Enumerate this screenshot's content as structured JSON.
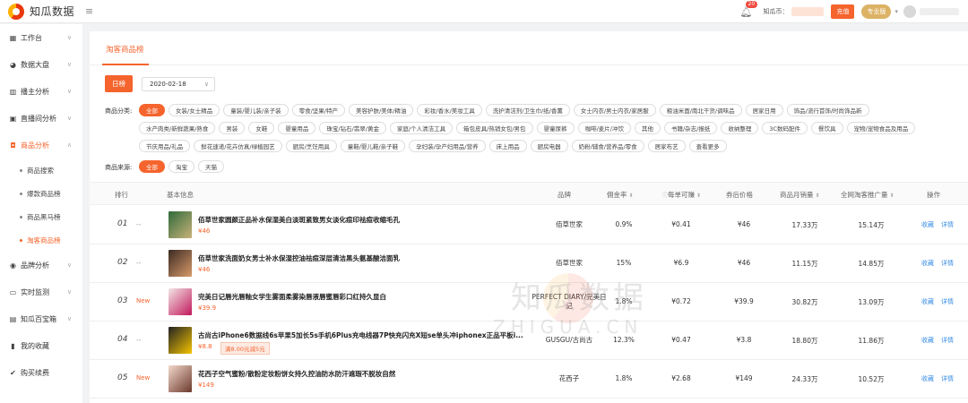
{
  "header": {
    "logo_text": "知瓜数据",
    "menu_icon": "menu-icon",
    "bell_badge": "20",
    "coin_label": "知瓜币：",
    "recharge_label": "充值",
    "vip_label": "专业版"
  },
  "sidebar": {
    "items": [
      {
        "label": "工作台",
        "icon": "grid-icon"
      },
      {
        "label": "数据大盘",
        "icon": "pie-icon"
      },
      {
        "label": "播主分析",
        "icon": "bar-icon"
      },
      {
        "label": "直播间分析",
        "icon": "tv-icon"
      },
      {
        "label": "商品分析",
        "icon": "bag-icon"
      },
      {
        "label": "品牌分析",
        "icon": "target-icon"
      },
      {
        "label": "实时监测",
        "icon": "monitor-icon"
      },
      {
        "label": "知瓜百宝箱",
        "icon": "box-icon"
      },
      {
        "label": "我的收藏",
        "icon": "bookmark-icon"
      },
      {
        "label": "购买续费",
        "icon": "cart-icon"
      }
    ],
    "sub_items": [
      "商品搜索",
      "爆款商品榜",
      "商品黑马榜",
      "淘客商品榜"
    ]
  },
  "main": {
    "tab_label": "淘客商品榜",
    "day_button": "日榜",
    "date_value": "2020-02-18",
    "category_label": "商品分类:",
    "categories": [
      "全部",
      "女装/女士精品",
      "童装/婴儿装/亲子装",
      "零食/坚果/特产",
      "美容护肤/美体/精油",
      "彩妆/香水/美妆工具",
      "洗护清洁剂/卫生巾/纸/香薰",
      "女士内衣/男士内衣/家居服",
      "粮油米面/南北干货/调味品",
      "居家日用",
      "饰品/流行首饰/时尚饰品新",
      "水产肉类/新鲜蔬果/熟食",
      "男装",
      "女鞋",
      "婴童用品",
      "珠宝/钻石/翡翠/黄金",
      "家庭/个人清洁工具",
      "箱包皮具/热销女包/男包",
      "婴童尿裤",
      "咖啡/麦片/冲饮",
      "其他",
      "书籍/杂志/报纸",
      "收纳整理",
      "3C数码配件",
      "餐饮具",
      "宠物/宠物食品及用品",
      "节庆用品/礼品",
      "鲜花速递/花卉仿真/绿植园艺",
      "厨房/烹饪用具",
      "童鞋/婴儿鞋/亲子鞋",
      "孕妇装/孕产妇用品/营养",
      "床上用品",
      "厨房电器",
      "奶粉/辅食/营养品/零食",
      "居家布艺",
      "查看更多"
    ],
    "source_label": "商品来源:",
    "sources": [
      "全部",
      "淘宝",
      "天猫"
    ],
    "table": {
      "headers": {
        "rank": "排行",
        "info": "基本信息",
        "brand": "品牌",
        "commission": "佣金率",
        "per_order": "每单可赚",
        "after_coupon": "券后价格",
        "monthly_sales": "商品月销量",
        "promo_count": "全网淘客推广量",
        "action": "操作"
      },
      "rows": [
        {
          "rank": "01",
          "trend": "--",
          "name": "佰草世家圆颜正品补水保湿美白淡斑紧致男女淡化痘印祛痘收缩毛孔",
          "price": "¥46",
          "promo": "",
          "brand": "佰草世家",
          "commission": "0.9%",
          "per_order": "¥0.41",
          "after_coupon": "¥46",
          "monthly_sales": "17.33万",
          "promo_count": "15.14万"
        },
        {
          "rank": "02",
          "trend": "--",
          "name": "佰草世家洗面奶女男士补水保湿控油祛痘深层清洁黑头氨基酸洁面乳",
          "price": "¥46",
          "promo": "",
          "brand": "佰草世家",
          "commission": "15%",
          "per_order": "¥6.9",
          "after_coupon": "¥46",
          "monthly_sales": "11.15万",
          "promo_count": "14.85万"
        },
        {
          "rank": "03",
          "trend": "New",
          "name": "完美日记唇光唇釉女学生雾面柔雾染唇液唇蜜唇彩口红持久显白",
          "price": "¥39.9",
          "promo": "",
          "brand": "PERFECT DIARY/完美日记",
          "commission": "1.8%",
          "per_order": "¥0.72",
          "after_coupon": "¥39.9",
          "monthly_sales": "30.82万",
          "promo_count": "13.09万"
        },
        {
          "rank": "04",
          "trend": "--",
          "name": "古尚古iPhone6数据线6s苹果5加长5s手机6Plus充电线器7P快充闪充X短se单头冲iphonex正品平板i...",
          "price": "¥8.8",
          "promo": "满8.00元减5元",
          "brand": "GUSGU/古尚古",
          "commission": "12.3%",
          "per_order": "¥0.47",
          "after_coupon": "¥3.8",
          "monthly_sales": "18.80万",
          "promo_count": "11.86万"
        },
        {
          "rank": "05",
          "trend": "New",
          "name": "花西子空气蜜粉/散粉定妆粉饼女持久控油防水防汗遮瑕不脱妆自然",
          "price": "¥149",
          "promo": "",
          "brand": "花西子",
          "commission": "1.8%",
          "per_order": "¥2.68",
          "after_coupon": "¥149",
          "monthly_sales": "24.33万",
          "promo_count": "10.52万"
        }
      ],
      "action_fav": "收藏",
      "action_detail": "详情"
    }
  },
  "watermark": {
    "text": "知瓜数据",
    "sub": "ZHIGUA.CN"
  },
  "colors": {
    "accent": "#f5642d",
    "link": "#3a8ee6"
  }
}
